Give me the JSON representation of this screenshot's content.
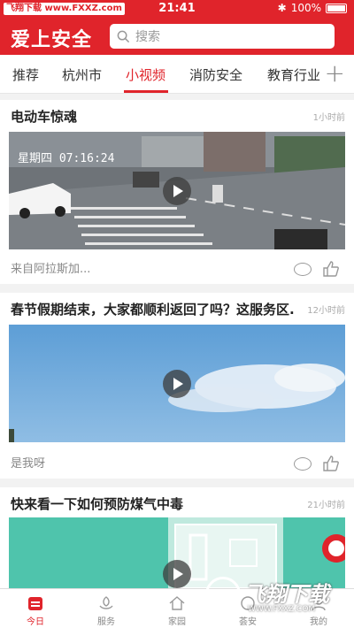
{
  "status": {
    "left_badge": "飞翔下载 www.FXXZ.com",
    "time": "21:41",
    "battery": "100%"
  },
  "header": {
    "logo": "爱上安全",
    "search_placeholder": "搜索"
  },
  "tabs": [
    {
      "label": "推荐"
    },
    {
      "label": "杭州市"
    },
    {
      "label": "小视频"
    },
    {
      "label": "消防安全"
    },
    {
      "label": "教育行业"
    }
  ],
  "feed": [
    {
      "title": "电动车惊魂",
      "time": "1小时前",
      "source": "来自阿拉斯加...",
      "overlay": "星期四 07:16:24"
    },
    {
      "title": "春节假期结束，大家都顺利返回了吗？这服务区...",
      "time": "12小时前",
      "source": "是我呀"
    },
    {
      "title": "快来看一下如何预防煤气中毒",
      "time": "21小时前"
    }
  ],
  "bottom_nav": [
    {
      "label": "今日"
    },
    {
      "label": "服务"
    },
    {
      "label": "家园"
    },
    {
      "label": "荟安"
    },
    {
      "label": "我的"
    }
  ],
  "watermark": {
    "main": "飞翔下载",
    "sub": "WWW.FXXZ.COM"
  },
  "colors": {
    "brand": "#e0242b"
  }
}
